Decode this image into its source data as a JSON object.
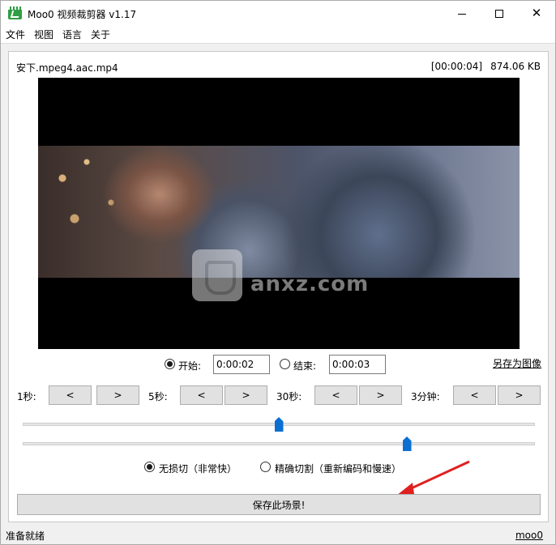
{
  "window": {
    "title": "Moo0 视频裁剪器 v1.17",
    "controls": {
      "minimize": "—",
      "maximize": "☐",
      "close": "✕"
    }
  },
  "menu": [
    "文件",
    "视图",
    "语言",
    "关于"
  ],
  "file": {
    "name": "安下.mpeg4.aac.mp4",
    "duration": "[00:00:04]",
    "size": "874.06 KB"
  },
  "video": {
    "watermark_text": "anxz.com"
  },
  "range": {
    "start_label": "开始:",
    "start_value": "0:00:02",
    "start_selected": true,
    "end_label": "结束:",
    "end_value": "0:00:03",
    "end_selected": false,
    "save_image_link": "另存为图像"
  },
  "steps": [
    {
      "label": "1秒:",
      "back": "<",
      "forward": ">"
    },
    {
      "label": "5秒:",
      "back": "<",
      "forward": ">"
    },
    {
      "label": "30秒:",
      "back": "<",
      "forward": ">"
    },
    {
      "label": "3分钟:",
      "back": "<",
      "forward": ">"
    }
  ],
  "sliders": {
    "start_position": 0.5,
    "end_position": 0.75
  },
  "modes": {
    "lossless_label": "无损切（非常快）",
    "lossless_selected": true,
    "precise_label": "精确切割（重新编码和慢速）",
    "precise_selected": false
  },
  "save_button": "保存此场景!",
  "status": {
    "text": "准备就绪",
    "link": "moo0"
  },
  "colors": {
    "slider_thumb": "#0a6fd1",
    "annotation_arrow": "#e02020"
  }
}
